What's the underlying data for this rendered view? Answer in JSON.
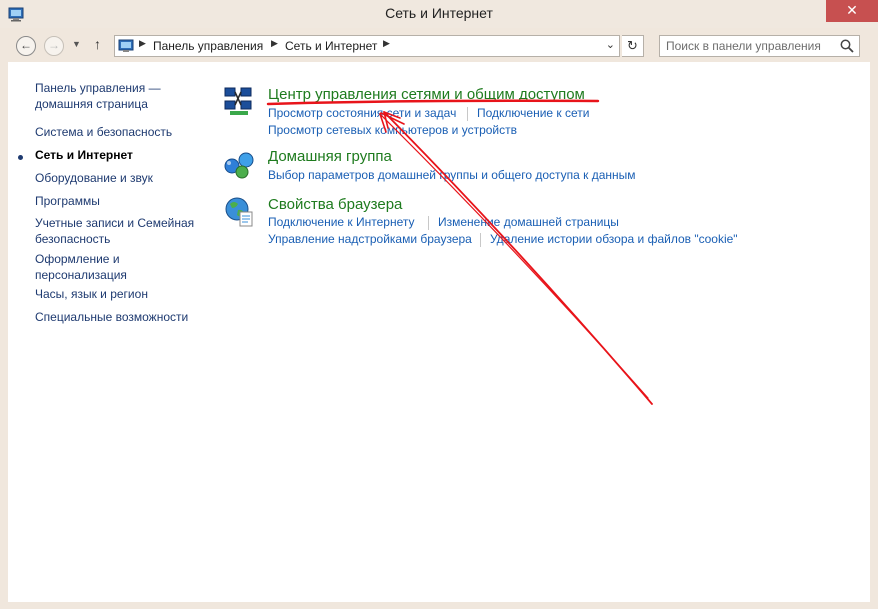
{
  "window": {
    "title": "Сеть и Интернет",
    "close_label": "✕"
  },
  "nav": {
    "back_icon": "arrow-left",
    "forward_icon": "arrow-right",
    "recent_icon": "chevron-down",
    "up_icon": "arrow-up",
    "breadcrumbs": [
      "Панель управления",
      "Сеть и Интернет"
    ],
    "refresh_icon": "refresh",
    "search_placeholder": "Поиск в панели управления"
  },
  "sidebar": {
    "items": [
      {
        "label": "Панель управления — домашняя страница"
      },
      {
        "label": "Система и безопасность"
      },
      {
        "label": "Сеть и Интернет"
      },
      {
        "label": "Оборудование и звук"
      },
      {
        "label": "Программы"
      },
      {
        "label": "Учетные записи и Семейная безопасность"
      },
      {
        "label": "Оформление и персонализация"
      },
      {
        "label": "Часы, язык и регион"
      },
      {
        "label": "Специальные возможности"
      }
    ]
  },
  "categories": [
    {
      "title": "Центр управления сетями и общим доступом",
      "icon": "network-center-icon",
      "tasks": [
        "Просмотр состояния сети и задач",
        "Подключение к сети",
        "Просмотр сетевых компьютеров и устройств"
      ]
    },
    {
      "title": "Домашняя группа",
      "icon": "homegroup-icon",
      "tasks": [
        "Выбор параметров домашней группы и общего доступа к данным"
      ]
    },
    {
      "title": "Свойства браузера",
      "icon": "internet-options-icon",
      "tasks": [
        "Подключение к Интернету",
        "Изменение домашней страницы",
        "Управление надстройками браузера",
        "Удаление истории обзора и файлов \"cookie\""
      ]
    }
  ],
  "colors": {
    "category_title": "#1e7b1e",
    "task_link": "#1a5fb4",
    "annotation": "#e8141a"
  }
}
